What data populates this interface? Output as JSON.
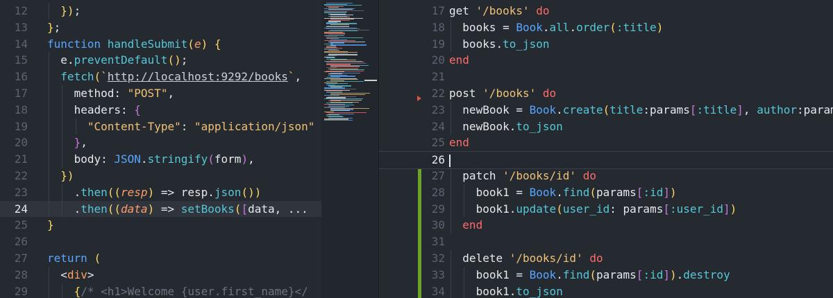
{
  "left_editor": {
    "active_line": 24,
    "lines": [
      {
        "n": "12",
        "indent": 1,
        "tokens": [
          [
            "p",
            "})"
          ],
          [
            "n",
            ";"
          ]
        ]
      },
      {
        "n": "13",
        "indent": 0,
        "tokens": [
          [
            "p",
            "}"
          ],
          [
            "n",
            ";"
          ]
        ]
      },
      {
        "n": "14",
        "indent": 0,
        "tokens": [
          [
            "k",
            "function "
          ],
          [
            "m",
            "handleSubmit"
          ],
          [
            "p",
            "("
          ],
          [
            "it",
            "e"
          ],
          [
            "p",
            ")"
          ],
          [
            "n",
            " "
          ],
          [
            "p",
            "{"
          ]
        ]
      },
      {
        "n": "15",
        "indent": 1,
        "tokens": [
          [
            "n",
            "e"
          ],
          [
            "n",
            "."
          ],
          [
            "m",
            "preventDefault"
          ],
          [
            "p",
            "()"
          ],
          [
            "n",
            ";"
          ]
        ]
      },
      {
        "n": "16",
        "indent": 1,
        "tokens": [
          [
            "m",
            "fetch"
          ],
          [
            "p",
            "("
          ],
          [
            "s",
            "`"
          ],
          [
            "u",
            "http://localhost:9292/books"
          ],
          [
            "s",
            "`"
          ],
          [
            "n",
            ", "
          ]
        ]
      },
      {
        "n": "17",
        "indent": 2,
        "tokens": [
          [
            "n",
            "method: "
          ],
          [
            "s",
            "\"POST\""
          ],
          [
            "n",
            ","
          ]
        ]
      },
      {
        "n": "18",
        "indent": 2,
        "tokens": [
          [
            "n",
            "headers: "
          ],
          [
            "pp",
            "{"
          ]
        ]
      },
      {
        "n": "19",
        "indent": 3,
        "tokens": [
          [
            "s",
            "\"Content-Type\""
          ],
          [
            "n",
            ": "
          ],
          [
            "s",
            "\"application/json\""
          ]
        ]
      },
      {
        "n": "20",
        "indent": 2,
        "tokens": [
          [
            "pp",
            "}"
          ],
          [
            "n",
            ","
          ]
        ]
      },
      {
        "n": "21",
        "indent": 2,
        "tokens": [
          [
            "n",
            "body: "
          ],
          [
            "cls",
            "JSON"
          ],
          [
            "n",
            "."
          ],
          [
            "m",
            "stringify"
          ],
          [
            "pp",
            "("
          ],
          [
            "n",
            "form"
          ],
          [
            "pp",
            ")"
          ],
          [
            "n",
            ","
          ]
        ]
      },
      {
        "n": "22",
        "indent": 1,
        "tokens": [
          [
            "p",
            "})"
          ]
        ]
      },
      {
        "n": "23",
        "indent": 2,
        "tokens": [
          [
            "n",
            "."
          ],
          [
            "m",
            "then"
          ],
          [
            "p",
            "(("
          ],
          [
            "it",
            "resp"
          ],
          [
            "p",
            ")"
          ],
          [
            "n",
            " => "
          ],
          [
            "n",
            "resp."
          ],
          [
            "m",
            "json"
          ],
          [
            "p",
            "())"
          ]
        ]
      },
      {
        "n": "24",
        "indent": 2,
        "tokens": [
          [
            "n",
            "."
          ],
          [
            "m",
            "then"
          ],
          [
            "p",
            "(("
          ],
          [
            "it",
            "data"
          ],
          [
            "p",
            ")"
          ],
          [
            "n",
            " => "
          ],
          [
            "m",
            "setBooks"
          ],
          [
            "p",
            "("
          ],
          [
            "pp",
            "["
          ],
          [
            "n",
            "data, ..."
          ]
        ]
      },
      {
        "n": "25",
        "indent": 0,
        "tokens": [
          [
            "p",
            "}"
          ]
        ]
      },
      {
        "n": "26",
        "indent": 0,
        "tokens": []
      },
      {
        "n": "27",
        "indent": 0,
        "tokens": [
          [
            "k",
            "return "
          ],
          [
            "p",
            "("
          ]
        ]
      },
      {
        "n": "28",
        "indent": 1,
        "tokens": [
          [
            "n",
            "<"
          ],
          [
            "tag",
            "div"
          ],
          [
            "n",
            ">"
          ]
        ]
      },
      {
        "n": "29",
        "indent": 2,
        "tokens": [
          [
            "p",
            "{"
          ],
          [
            "cm",
            "/* <h1>Welcome {user.first_name}</"
          ]
        ]
      }
    ]
  },
  "right_editor": {
    "active_line": 26,
    "lines": [
      {
        "n": "17",
        "indent": 0,
        "tokens": [
          [
            "n",
            "get "
          ],
          [
            "s",
            "'/books'"
          ],
          [
            "kr",
            " do"
          ]
        ]
      },
      {
        "n": "18",
        "indent": 1,
        "tokens": [
          [
            "n",
            "books = "
          ],
          [
            "cls",
            "Book"
          ],
          [
            "n",
            "."
          ],
          [
            "m",
            "all"
          ],
          [
            "n",
            "."
          ],
          [
            "m",
            "order"
          ],
          [
            "p",
            "("
          ],
          [
            "sym",
            ":title"
          ],
          [
            "p",
            ")"
          ]
        ]
      },
      {
        "n": "19",
        "indent": 1,
        "tokens": [
          [
            "n",
            "books."
          ],
          [
            "m",
            "to_json"
          ]
        ]
      },
      {
        "n": "20",
        "indent": 0,
        "tokens": [
          [
            "kr",
            "end"
          ]
        ]
      },
      {
        "n": "21",
        "indent": 0,
        "tokens": []
      },
      {
        "n": "22",
        "indent": 0,
        "tokens": [
          [
            "n",
            "post "
          ],
          [
            "s",
            "'/books'"
          ],
          [
            "kr",
            " do"
          ]
        ]
      },
      {
        "n": "23",
        "indent": 1,
        "tokens": [
          [
            "n",
            "newBook = "
          ],
          [
            "cls",
            "Book"
          ],
          [
            "n",
            "."
          ],
          [
            "m",
            "create"
          ],
          [
            "p",
            "("
          ],
          [
            "m",
            "title"
          ],
          [
            "n",
            ":params"
          ],
          [
            "pp",
            "["
          ],
          [
            "sym",
            ":title"
          ],
          [
            "pp",
            "]"
          ],
          [
            "n",
            ", "
          ],
          [
            "m",
            "author"
          ],
          [
            "n",
            ":param"
          ]
        ]
      },
      {
        "n": "24",
        "indent": 1,
        "tokens": [
          [
            "n",
            "newBook."
          ],
          [
            "m",
            "to_json"
          ]
        ]
      },
      {
        "n": "25",
        "indent": 0,
        "tokens": [
          [
            "kr",
            "end"
          ]
        ]
      },
      {
        "n": "26",
        "indent": 0,
        "tokens": [
          [
            "caret",
            ""
          ]
        ]
      },
      {
        "n": "27",
        "indent": 1,
        "tokens": [
          [
            "n",
            "patch "
          ],
          [
            "s",
            "'/books/id'"
          ],
          [
            "kr",
            " do"
          ]
        ]
      },
      {
        "n": "28",
        "indent": 2,
        "tokens": [
          [
            "n",
            "book1 = "
          ],
          [
            "cls",
            "Book"
          ],
          [
            "n",
            "."
          ],
          [
            "m",
            "find"
          ],
          [
            "p",
            "("
          ],
          [
            "n",
            "params"
          ],
          [
            "pp",
            "["
          ],
          [
            "sym",
            ":id"
          ],
          [
            "pp",
            "]"
          ],
          [
            "p",
            ")"
          ]
        ]
      },
      {
        "n": "29",
        "indent": 2,
        "tokens": [
          [
            "n",
            "book1."
          ],
          [
            "m",
            "update"
          ],
          [
            "p",
            "("
          ],
          [
            "m",
            "user_id"
          ],
          [
            "n",
            ": params"
          ],
          [
            "pp",
            "["
          ],
          [
            "sym",
            ":user_id"
          ],
          [
            "pp",
            "]"
          ],
          [
            "p",
            ")"
          ]
        ]
      },
      {
        "n": "30",
        "indent": 1,
        "tokens": [
          [
            "kr",
            "end"
          ]
        ]
      },
      {
        "n": "31",
        "indent": 0,
        "tokens": []
      },
      {
        "n": "32",
        "indent": 1,
        "tokens": [
          [
            "n",
            "delete "
          ],
          [
            "s",
            "'/books/id'"
          ],
          [
            "kr",
            " do"
          ]
        ]
      },
      {
        "n": "33",
        "indent": 2,
        "tokens": [
          [
            "n",
            "book1 = "
          ],
          [
            "cls",
            "Book"
          ],
          [
            "n",
            "."
          ],
          [
            "m",
            "find"
          ],
          [
            "p",
            "("
          ],
          [
            "n",
            "params"
          ],
          [
            "pp",
            "["
          ],
          [
            "sym",
            ":id"
          ],
          [
            "pp",
            "]"
          ],
          [
            "p",
            ")"
          ],
          [
            "n",
            "."
          ],
          [
            "m",
            "destroy"
          ]
        ]
      },
      {
        "n": "34",
        "indent": 2,
        "tokens": [
          [
            "n",
            "book1."
          ],
          [
            "m",
            "to_json"
          ]
        ]
      }
    ]
  }
}
